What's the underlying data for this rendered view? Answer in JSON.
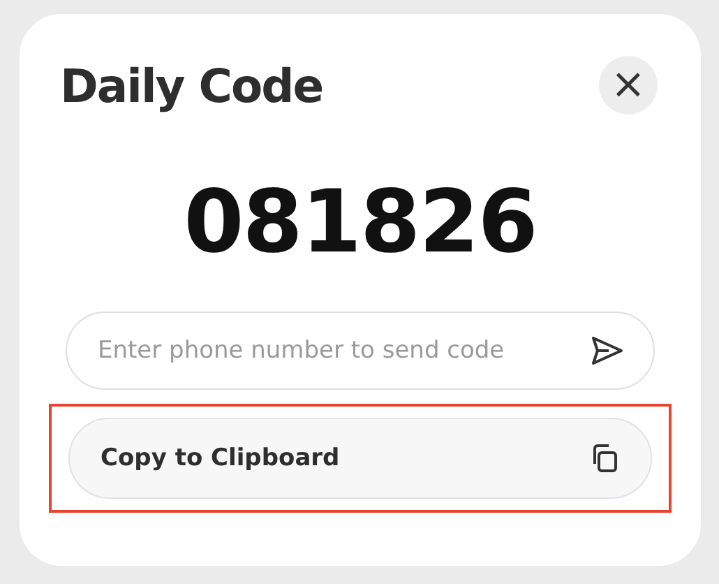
{
  "dialog": {
    "title": "Daily Code",
    "close_label": "×"
  },
  "code": "081826",
  "phone_field": {
    "placeholder": "Enter phone number to send code"
  },
  "copy_button": {
    "label": "Copy to Clipboard",
    "highlighted": true
  }
}
